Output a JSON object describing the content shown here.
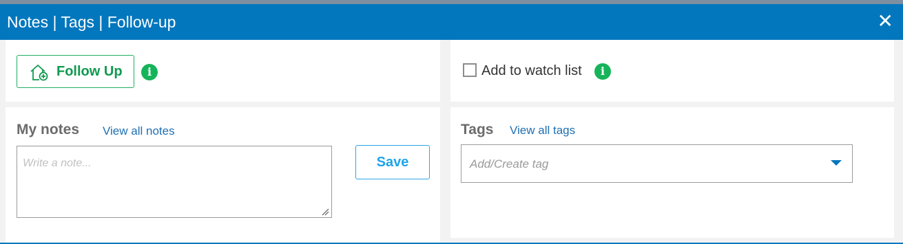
{
  "window": {
    "title": "Notes | Tags | Follow-up",
    "close_glyph": "✕"
  },
  "follow_up": {
    "button_label": "Follow Up",
    "icon": "home-plus-icon",
    "info_glyph": "i"
  },
  "watch": {
    "label": "Add to watch list",
    "checked": false,
    "info_glyph": "i"
  },
  "notes": {
    "heading": "My notes",
    "view_all": "View all notes",
    "placeholder": "Write a note...",
    "value": "",
    "save_label": "Save"
  },
  "tags": {
    "heading": "Tags",
    "view_all": "View all tags",
    "placeholder": "Add/Create tag"
  },
  "colors": {
    "titlebar": "#0277bd",
    "follow_green": "#0f9a4f",
    "info_green": "#16b45a",
    "link_blue": "#1f6fb2",
    "save_blue": "#1ea3ea"
  }
}
